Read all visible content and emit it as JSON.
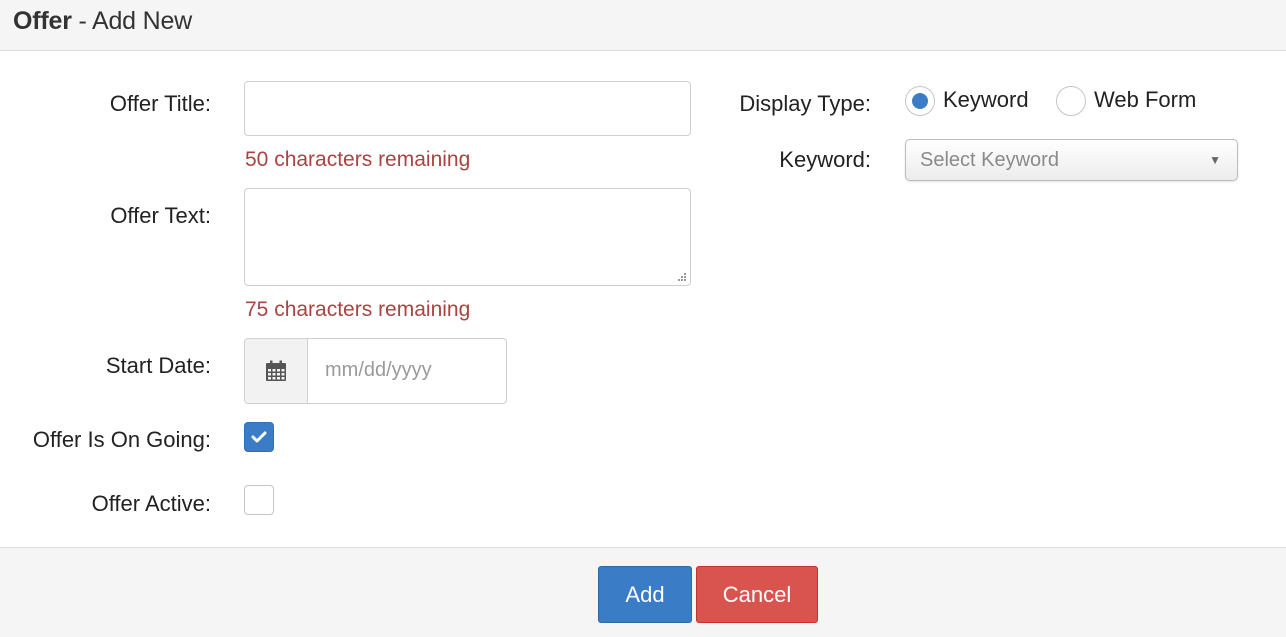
{
  "header": {
    "title_bold": "Offer",
    "title_rest": " - Add New"
  },
  "form": {
    "offer_title": {
      "label": "Offer Title:",
      "value": "",
      "hint": "50 characters remaining"
    },
    "offer_text": {
      "label": "Offer Text:",
      "value": "",
      "hint": "75 characters remaining"
    },
    "start_date": {
      "label": "Start Date:",
      "placeholder": "mm/dd/yyyy",
      "icon": "calendar-icon"
    },
    "on_going": {
      "label": "Offer Is On Going:",
      "checked": true
    },
    "active": {
      "label": "Offer Active:",
      "checked": false
    },
    "display_type": {
      "label": "Display Type:",
      "options": [
        "Keyword",
        "Web Form"
      ],
      "selected": "Keyword"
    },
    "keyword": {
      "label": "Keyword:",
      "placeholder": "Select Keyword"
    }
  },
  "footer": {
    "add_label": "Add",
    "cancel_label": "Cancel"
  },
  "colors": {
    "primary": "#3a7dc6",
    "danger": "#d9534f",
    "hint": "#a94442"
  }
}
